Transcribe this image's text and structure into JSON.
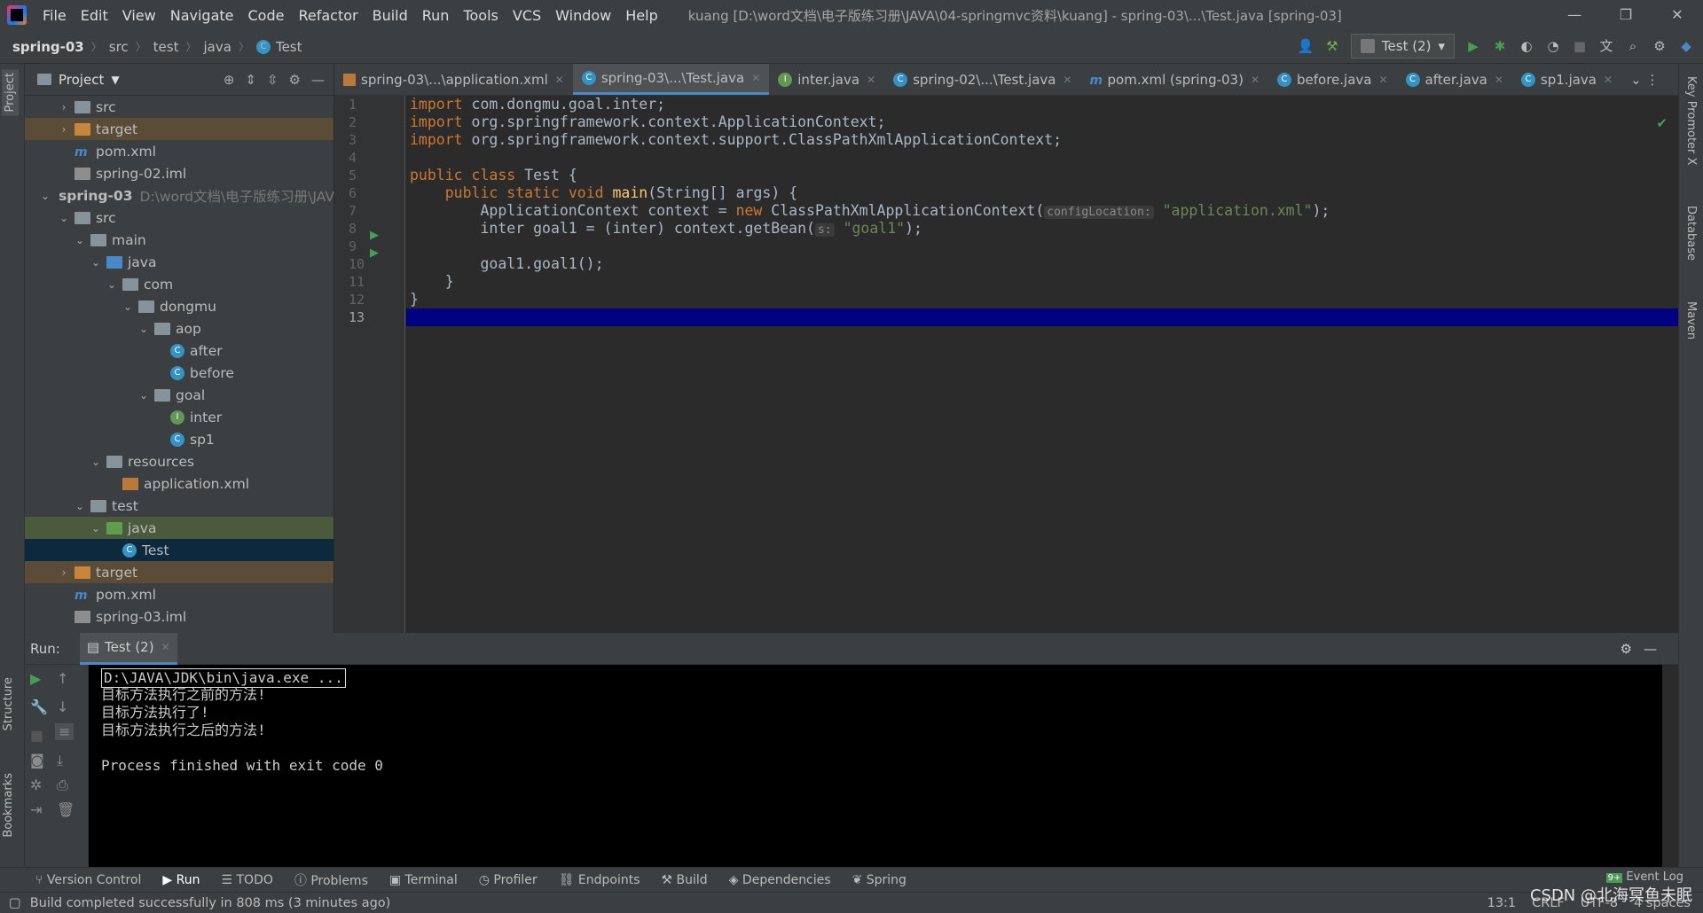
{
  "menubar": {
    "items": [
      "File",
      "Edit",
      "View",
      "Navigate",
      "Code",
      "Refactor",
      "Build",
      "Run",
      "Tools",
      "VCS",
      "Window",
      "Help"
    ],
    "title": "kuang [D:\\word文档\\电子版练习册\\JAVA\\04-springmvc资料\\kuang] - spring-03\\...\\Test.java [spring-03]"
  },
  "breadcrumb": {
    "project": "spring-03",
    "src": "src",
    "test": "test",
    "java": "java",
    "cls": "Test"
  },
  "toolbar": {
    "run_config": "Test (2)"
  },
  "project": {
    "title": "Project",
    "rows": [
      {
        "label": "src",
        "lvl": 1,
        "arrow": "›",
        "icon": "folder"
      },
      {
        "label": "target",
        "lvl": 1,
        "arrow": "›",
        "icon": "folder orange",
        "cls": "exc"
      },
      {
        "label": "pom.xml",
        "lvl": 1,
        "arrow": "",
        "icon": "mvn"
      },
      {
        "label": "spring-02.iml",
        "lvl": 1,
        "arrow": "",
        "icon": "iml"
      },
      {
        "label": "spring-03",
        "lvl": 0,
        "arrow": "⌄",
        "icon": "folder",
        "bold": true,
        "extra": "D:\\word文档\\电子版练习册\\JAV"
      },
      {
        "label": "src",
        "lvl": 1,
        "arrow": "⌄",
        "icon": "folder"
      },
      {
        "label": "main",
        "lvl": 2,
        "arrow": "⌄",
        "icon": "folder"
      },
      {
        "label": "java",
        "lvl": 3,
        "arrow": "⌄",
        "icon": "folder blue"
      },
      {
        "label": "com",
        "lvl": 4,
        "arrow": "⌄",
        "icon": "folder"
      },
      {
        "label": "dongmu",
        "lvl": 5,
        "arrow": "⌄",
        "icon": "folder"
      },
      {
        "label": "aop",
        "lvl": 6,
        "arrow": "⌄",
        "icon": "folder"
      },
      {
        "label": "after",
        "lvl": 7,
        "arrow": "",
        "icon": "cls"
      },
      {
        "label": "before",
        "lvl": 7,
        "arrow": "",
        "icon": "cls"
      },
      {
        "label": "goal",
        "lvl": 6,
        "arrow": "⌄",
        "icon": "folder"
      },
      {
        "label": "inter",
        "lvl": 7,
        "arrow": "",
        "icon": "cls i"
      },
      {
        "label": "sp1",
        "lvl": 7,
        "arrow": "",
        "icon": "cls"
      },
      {
        "label": "resources",
        "lvl": 3,
        "arrow": "⌄",
        "icon": "folder"
      },
      {
        "label": "application.xml",
        "lvl": 4,
        "arrow": "",
        "icon": "xml"
      },
      {
        "label": "test",
        "lvl": 2,
        "arrow": "⌄",
        "icon": "folder"
      },
      {
        "label": "java",
        "lvl": 3,
        "arrow": "⌄",
        "icon": "folder green",
        "cls": "selg"
      },
      {
        "label": "Test",
        "lvl": 4,
        "arrow": "",
        "icon": "cls",
        "cls": "sel"
      },
      {
        "label": "target",
        "lvl": 1,
        "arrow": "›",
        "icon": "folder orange",
        "cls": "exc"
      },
      {
        "label": "pom.xml",
        "lvl": 1,
        "arrow": "",
        "icon": "mvn"
      },
      {
        "label": "spring-03.iml",
        "lvl": 1,
        "arrow": "",
        "icon": "iml"
      }
    ]
  },
  "tabs": [
    {
      "label": "spring-03\\...\\application.xml",
      "icon": "xml"
    },
    {
      "label": "spring-03\\...\\Test.java",
      "icon": "cls",
      "active": true
    },
    {
      "label": "inter.java",
      "icon": "cls i"
    },
    {
      "label": "spring-02\\...\\Test.java",
      "icon": "cls"
    },
    {
      "label": "pom.xml (spring-03)",
      "icon": "mvn"
    },
    {
      "label": "before.java",
      "icon": "cls"
    },
    {
      "label": "after.java",
      "icon": "cls"
    },
    {
      "label": "sp1.java",
      "icon": "cls"
    }
  ],
  "code": {
    "lines": [
      "<span class=\"kw\">import</span> com.dongmu.goal.inter;",
      "<span class=\"kw\">import</span> org.springframework.context.ApplicationContext;",
      "<span class=\"kw\">import</span> org.springframework.context.support.ClassPathXmlApplicationContext;",
      "",
      "<span class=\"kw\">public class</span> Test {",
      "    <span class=\"kw\">public static void</span> <span class=\"fn\">main</span>(String[] args) {",
      "        ApplicationContext context = <span class=\"kw\">new</span> ClassPathXmlApplicationContext(<span class=\"hint\">configLocation:</span> <span class=\"str\">\"application.xml\"</span>);",
      "        inter goal1 = (inter) context.getBean(<span class=\"hint\">s:</span> <span class=\"str\">\"goal1\"</span>);",
      "",
      "        goal1.goal1();",
      "    }",
      "}",
      ""
    ]
  },
  "run": {
    "label": "Run:",
    "tab": "Test (2)",
    "console": [
      "D:\\JAVA\\JDK\\bin\\java.exe ...",
      "目标方法执行之前的方法!",
      "目标方法执行了!",
      "目标方法执行之后的方法!",
      "",
      "Process finished with exit code 0"
    ]
  },
  "bottom": {
    "items": [
      "Version Control",
      "Run",
      "TODO",
      "Problems",
      "Terminal",
      "Profiler",
      "Endpoints",
      "Build",
      "Dependencies",
      "Spring"
    ]
  },
  "status": {
    "message": "Build completed successfully in 808 ms (3 minutes ago)",
    "pos": "13:1",
    "crlf": "CRLF",
    "enc": "UTF-8",
    "indent": "4 spaces",
    "event_log": "Event Log",
    "watermark": "CSDN @北海冥鱼未眠"
  },
  "sidetabs": {
    "project": "Project",
    "structure": "Structure",
    "bookmarks": "Bookmarks",
    "keypromoter": "Key Promoter X",
    "database": "Database",
    "maven": "Maven"
  }
}
